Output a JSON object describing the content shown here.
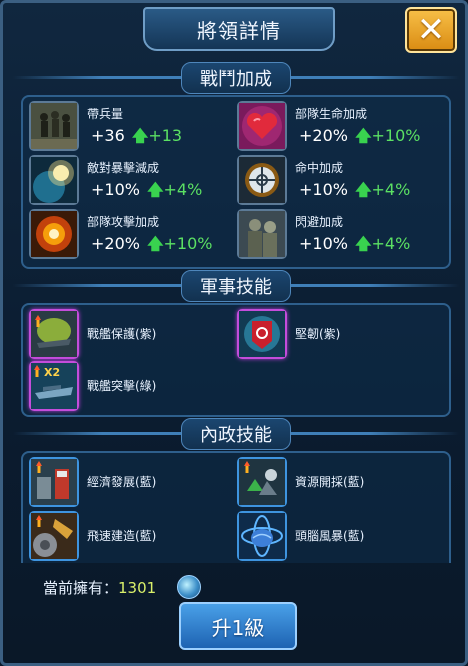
{
  "window": {
    "title": "將領詳情"
  },
  "combat": {
    "heading": "戰鬥加成",
    "entries": [
      {
        "name": "帶兵量",
        "value": "+36",
        "bonus": "+13",
        "icon": "troops-icon"
      },
      {
        "name": "部隊生命加成",
        "value": "+20%",
        "bonus": "+10%",
        "icon": "heart-icon"
      },
      {
        "name": "敵對暴擊減成",
        "value": "+10%",
        "bonus": "+4%",
        "icon": "planet-blast-icon"
      },
      {
        "name": "命中加成",
        "value": "+10%",
        "bonus": "+4%",
        "icon": "crosshair-icon"
      },
      {
        "name": "部隊攻擊加成",
        "value": "+20%",
        "bonus": "+10%",
        "icon": "explosion-icon"
      },
      {
        "name": "閃避加成",
        "value": "+10%",
        "bonus": "+4%",
        "icon": "soldiers-icon"
      }
    ]
  },
  "military": {
    "heading": "軍事技能",
    "skills": [
      {
        "name": "戰艦保護(紫)",
        "icon": "battleship-shield-icon",
        "rarity": "purple"
      },
      {
        "name": "堅韌(紫)",
        "icon": "target-armor-icon",
        "rarity": "purple"
      },
      {
        "name": "戰艦突擊(綠)",
        "icon": "battleship-x2-icon",
        "rarity": "purple",
        "badge": "x2"
      }
    ]
  },
  "civil": {
    "heading": "內政技能",
    "skills": [
      {
        "name": "經濟發展(藍)",
        "icon": "economy-icon",
        "rarity": "blue"
      },
      {
        "name": "資源開採(藍)",
        "icon": "mining-icon",
        "rarity": "blue"
      },
      {
        "name": "飛速建造(藍)",
        "icon": "construction-icon",
        "rarity": "blue"
      },
      {
        "name": "頭腦風暴(藍)",
        "icon": "brain-icon",
        "rarity": "blue"
      }
    ]
  },
  "footer": {
    "owned_label": "當前擁有：",
    "owned_value": "1301",
    "currency_icon": "medal-icon",
    "upgrade_label": "升1級"
  },
  "colors": {
    "bonus_green": "#5be063",
    "accent_gold": "#f0a726",
    "button_blue": "#2f7fd0"
  }
}
